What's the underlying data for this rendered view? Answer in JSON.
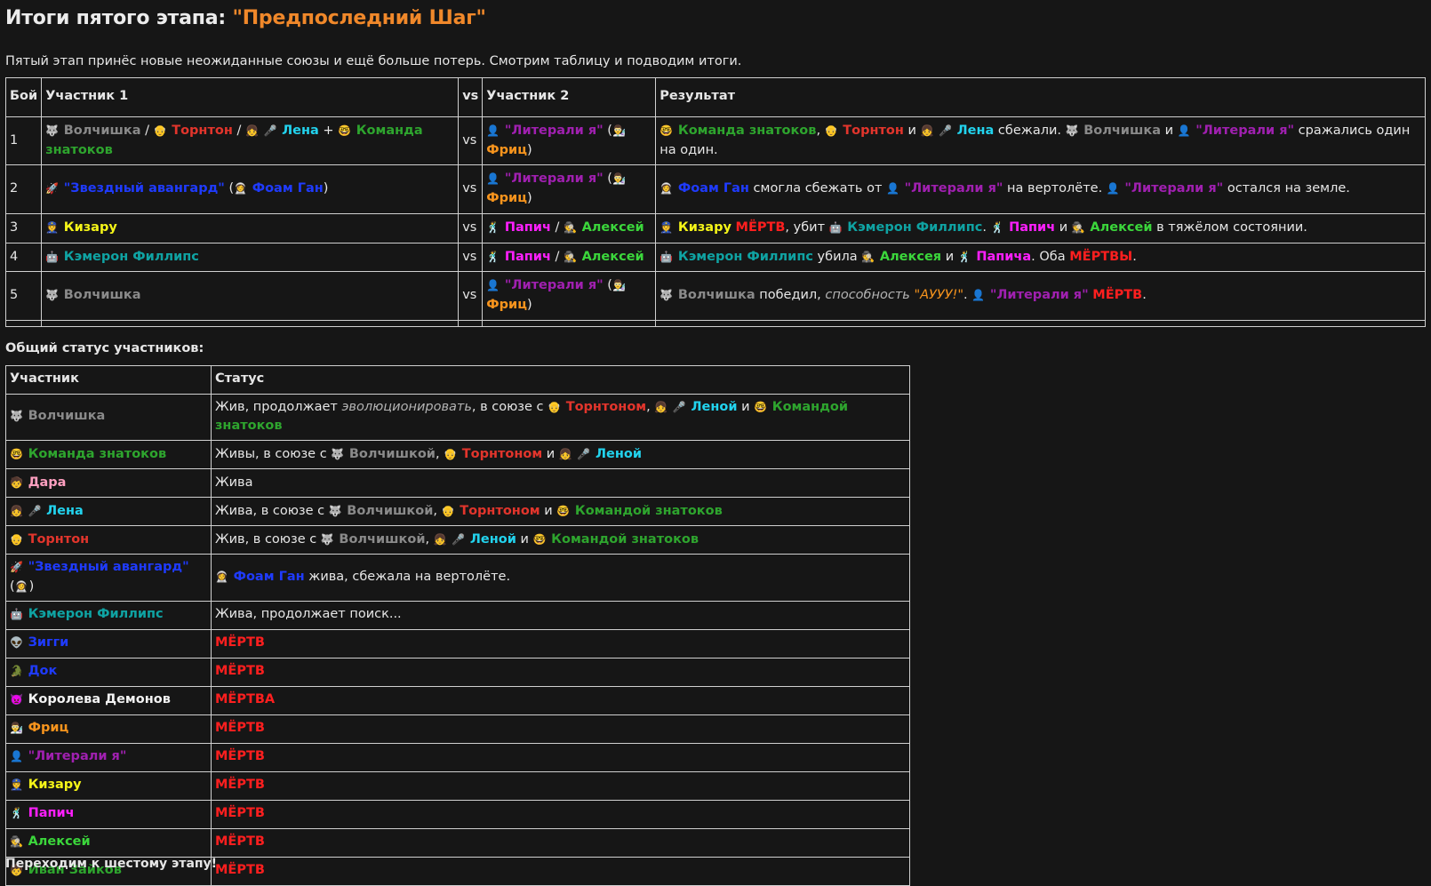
{
  "title": {
    "prefix": "Итоги пятого этапа: ",
    "quoted": "\"Предпоследний Шаг\""
  },
  "intro": "Пятый этап принёс новые неожиданные союзы и ещё больше потерь. Смотрим таблицу и подводим итоги.",
  "battle_table": {
    "headers": [
      "Бой",
      "Участник 1",
      "vs",
      "Участник 2",
      "Результат"
    ],
    "vs": "vs",
    "rows": [
      {
        "n": "1"
      },
      {
        "n": "2"
      },
      {
        "n": "3"
      },
      {
        "n": "4"
      },
      {
        "n": "5"
      }
    ]
  },
  "status_label": "Общий статус участников:",
  "status_table": {
    "headers": [
      "Участник",
      "Статус"
    ]
  },
  "names": {
    "volchishka": "Волчишка",
    "torntone": "Торнтон",
    "lena": "Лена",
    "komanda": "Команда знатоков",
    "literali": "\"Литерали я\"",
    "fritz": "Фриц",
    "zvezdny": "\"Звездный авангард\"",
    "foam": "Фоам Ган",
    "kizaru": "Кизару",
    "papich": "Папич",
    "aleksey": "Алексей",
    "cameron": "Кэмерон Филлипс",
    "dara": "Дара",
    "ziggy": "Зигги",
    "dok": "Док",
    "koroleva": "Королева Демонов",
    "ivan": "Иван Зайков"
  },
  "status_words": {
    "dead_m": "МЁРТВ",
    "dead_f": "МЁРТВА",
    "dead_pl": "МЁРТВЫ"
  },
  "icons": {
    "wolf": "🐺",
    "man": "👴",
    "girl": "👧",
    "mic": "🎤",
    "nerd": "🤓",
    "spy": "👤",
    "scientist": "👨‍🔬",
    "rocket": "🚀",
    "astronaut": "👩‍🚀",
    "officer": "👮",
    "dancer": "🕺",
    "detective": "🕵",
    "robot": "🤖",
    "alien": "👽",
    "croc": "🐊",
    "devil": "👿",
    "child": "🧒"
  },
  "footer": "Переходим к шестому этапу!"
}
